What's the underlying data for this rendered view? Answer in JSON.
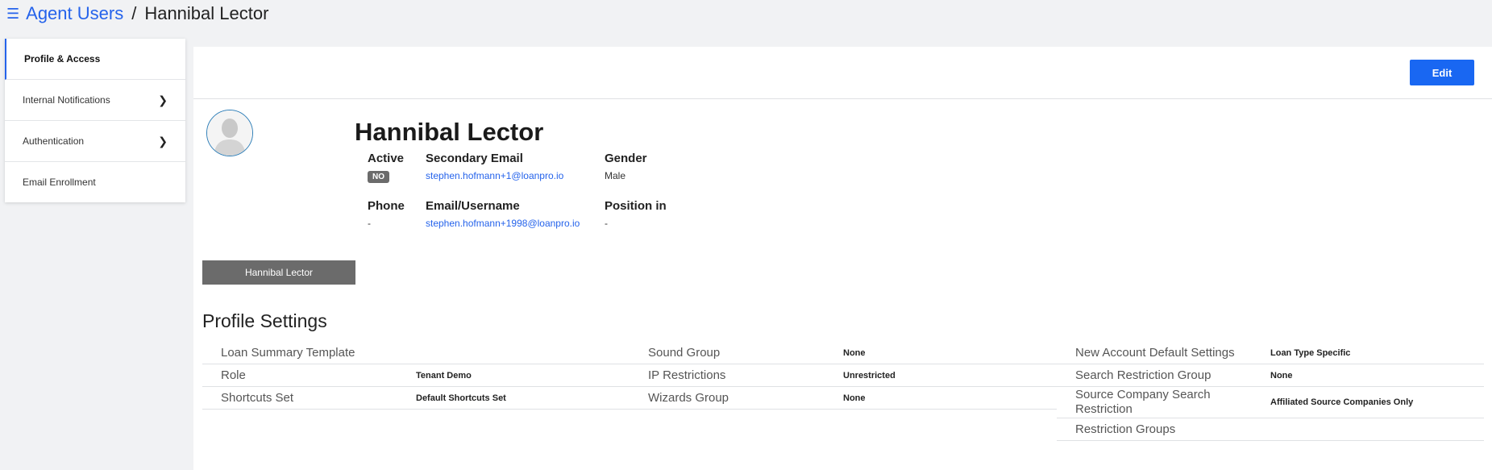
{
  "header": {
    "menu_icon": "☰",
    "breadcrumb_root": "Agent Users",
    "breadcrumb_sep": "/",
    "breadcrumb_current": "Hannibal Lector"
  },
  "sidebar": {
    "items": [
      {
        "label": "Profile & Access",
        "active": true
      },
      {
        "label": "Internal Notifications",
        "chevron": "❯"
      },
      {
        "label": "Authentication",
        "chevron": "❯"
      },
      {
        "label": "Email Enrollment"
      }
    ]
  },
  "toolbar": {
    "edit_label": "Edit"
  },
  "profile": {
    "name_tag": "Hannibal Lector",
    "full_name": "Hannibal Lector",
    "active_label": "Active",
    "active_value": "NO",
    "secondary_email_label": "Secondary Email",
    "secondary_email_value": "stephen.hofmann+1@loanpro.io",
    "gender_label": "Gender",
    "gender_value": "Male",
    "phone_label": "Phone",
    "phone_value": "-",
    "username_label": "Email/Username",
    "username_value": "stephen.hofmann+1998@loanpro.io",
    "position_label": "Position in",
    "position_value": "-"
  },
  "profile_settings": {
    "title": "Profile Settings",
    "col1": [
      {
        "label": "Loan Summary Template",
        "value": ""
      },
      {
        "label": "Role",
        "value": "Tenant Demo"
      },
      {
        "label": "Shortcuts Set",
        "value": "Default Shortcuts Set"
      }
    ],
    "col2": [
      {
        "label": "Sound Group",
        "value": "None"
      },
      {
        "label": "IP Restrictions",
        "value": "Unrestricted"
      },
      {
        "label": "Wizards Group",
        "value": "None"
      }
    ],
    "col3": [
      {
        "label": "New Account Default Settings",
        "value": "Loan Type Specific"
      },
      {
        "label": "Search Restriction Group",
        "value": "None"
      },
      {
        "label": "Source Company Search Restriction",
        "value": "Affiliated Source Companies Only"
      },
      {
        "label": "Restriction Groups",
        "value": ""
      }
    ]
  },
  "colors": {
    "accent": "#1967f2",
    "badge": "#6b6b6b",
    "link": "#2563eb"
  }
}
